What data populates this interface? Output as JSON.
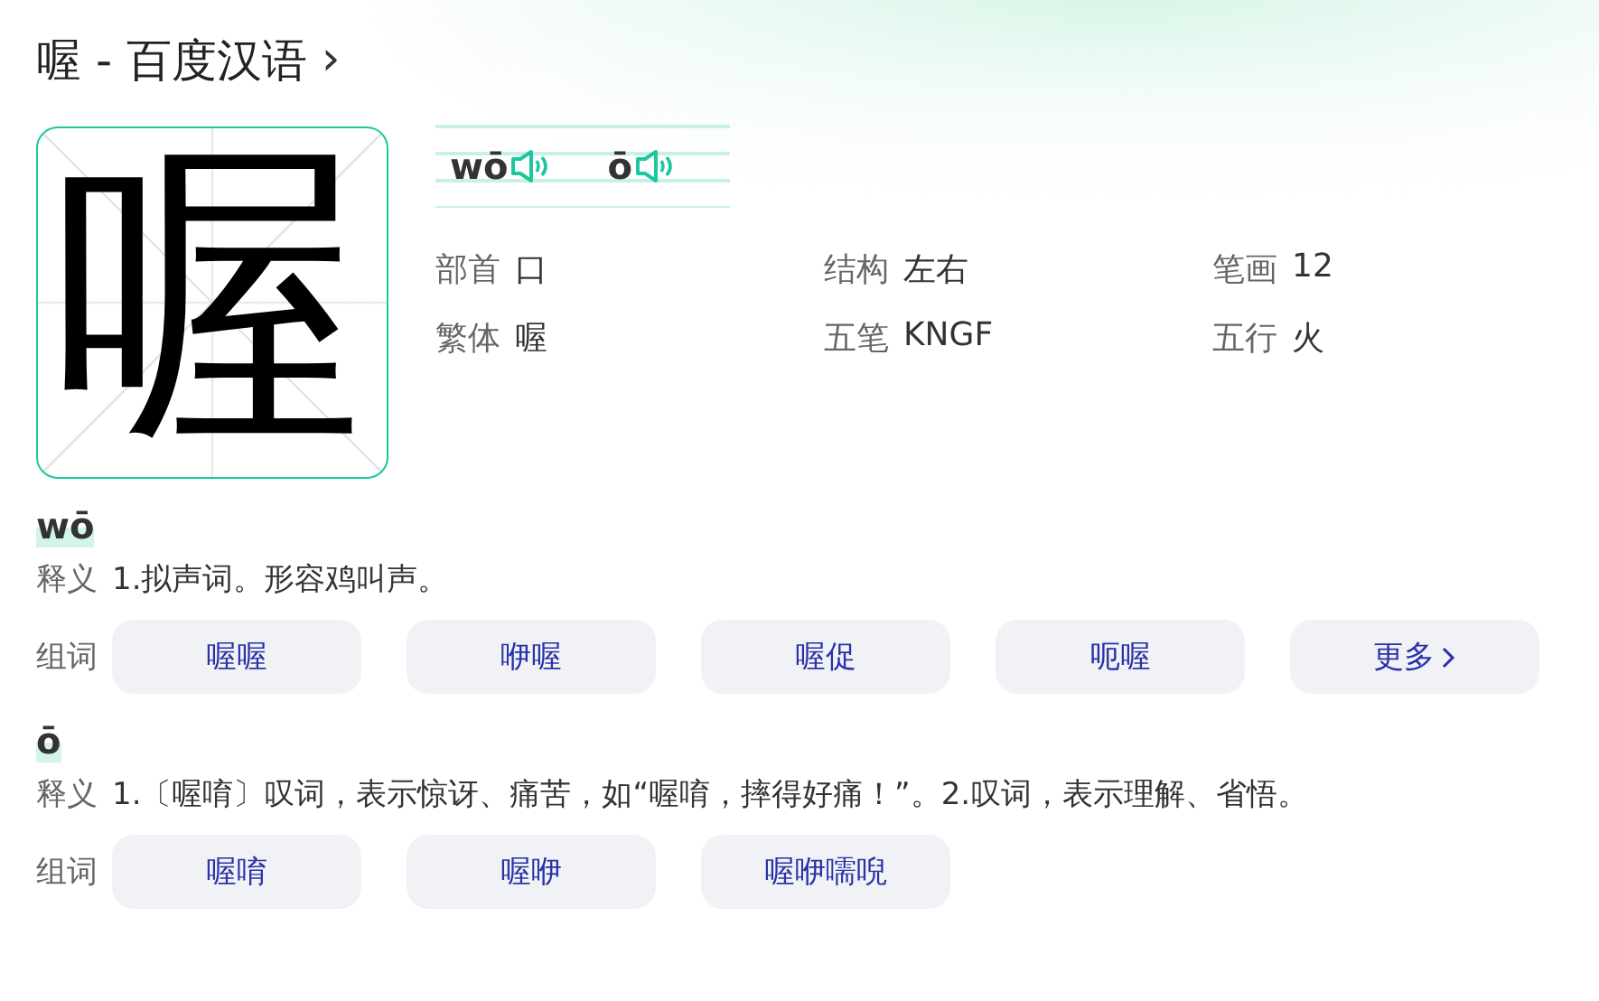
{
  "title": "喔 - 百度汉语",
  "title_arrow": "›",
  "character": "喔",
  "pronunciations": [
    {
      "pinyin": "wō"
    },
    {
      "pinyin": "ō"
    }
  ],
  "info": [
    {
      "label": "部首",
      "value": "口"
    },
    {
      "label": "结构",
      "value": "左右"
    },
    {
      "label": "笔画",
      "value": "12"
    },
    {
      "label": "繁体",
      "value": "喔"
    },
    {
      "label": "五笔",
      "value": "KNGF"
    },
    {
      "label": "五行",
      "value": "火"
    }
  ],
  "readings": [
    {
      "pinyin": "wō",
      "meaning_label": "释义",
      "meaning": "1.拟声词。形容鸡叫声。",
      "words_label": "组词",
      "words": [
        {
          "text": "喔喔",
          "kind": "word"
        },
        {
          "text": "咿喔",
          "kind": "word"
        },
        {
          "text": "喔促",
          "kind": "word"
        },
        {
          "text": "呃喔",
          "kind": "word"
        },
        {
          "text": "更多",
          "kind": "more"
        }
      ]
    },
    {
      "pinyin": "ō",
      "meaning_label": "释义",
      "meaning": "1.〔喔唷〕叹词，表示惊讶、痛苦，如“喔唷，摔得好痛！”。2.叹词，表示理解、省悟。",
      "words_label": "组词",
      "words": [
        {
          "text": "喔唷",
          "kind": "word"
        },
        {
          "text": "喔咿",
          "kind": "word"
        },
        {
          "text": "喔咿嚅唲",
          "kind": "word"
        }
      ]
    }
  ]
}
